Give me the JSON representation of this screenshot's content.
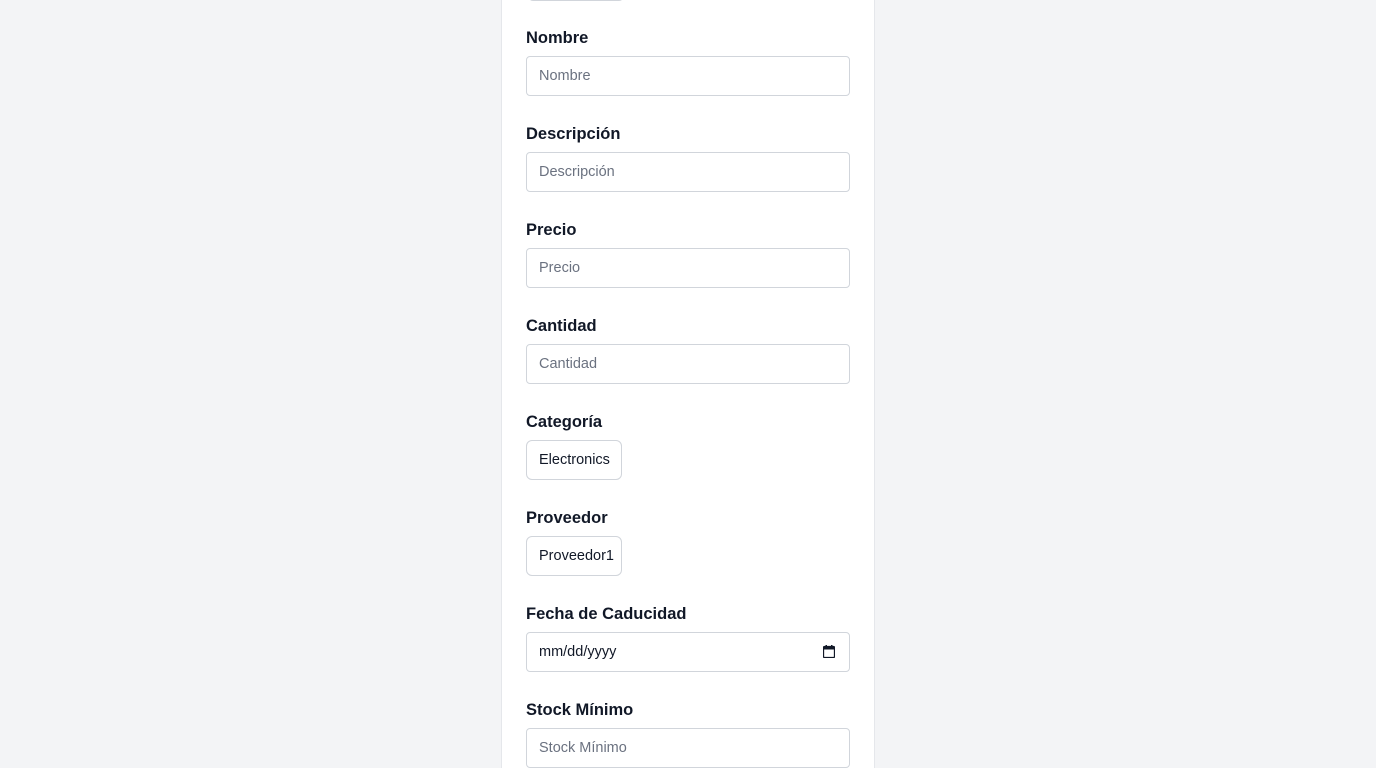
{
  "form": {
    "fields": [
      {
        "label": "Nombre",
        "placeholder": "Nombre"
      },
      {
        "label": "Descripción",
        "placeholder": "Descripción"
      },
      {
        "label": "Precio",
        "placeholder": "Precio"
      },
      {
        "label": "Cantidad",
        "placeholder": "Cantidad"
      }
    ],
    "categoria": {
      "label": "Categoría",
      "value": "Electronics"
    },
    "proveedor": {
      "label": "Proveedor",
      "value": "Proveedor1"
    },
    "fecha": {
      "label": "Fecha de Caducidad",
      "value": "mm/dd/yyyy",
      "icon": "calendar-icon"
    },
    "stock_minimo": {
      "label": "Stock Mínimo",
      "placeholder": "Stock Mínimo"
    }
  },
  "colors": {
    "page_background": "#f3f4f6",
    "card_background": "#ffffff",
    "border": "#d1d5db",
    "text": "#111827",
    "placeholder": "#6b7280"
  }
}
